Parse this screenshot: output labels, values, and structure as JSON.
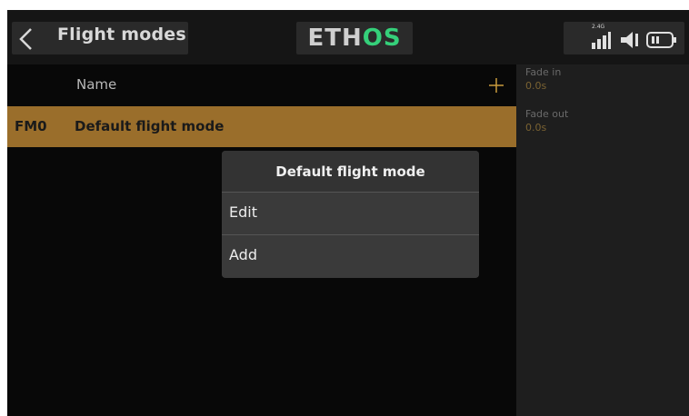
{
  "header": {
    "title": "Flight modes",
    "logo": {
      "part1": "ETH",
      "part2": "OS"
    },
    "status": {
      "band_label": "2.4G"
    }
  },
  "list": {
    "column_name": "Name",
    "rows": [
      {
        "id": "FM0",
        "name": "Default flight mode"
      }
    ]
  },
  "detail": {
    "fade_in_label": "Fade in",
    "fade_in_value": "0.0s",
    "fade_out_label": "Fade out",
    "fade_out_value": "0.0s"
  },
  "popup": {
    "title": "Default flight mode",
    "items": [
      "Edit",
      "Add"
    ]
  },
  "colors": {
    "accent_row": "#9a6e2b",
    "logo_green": "#35d07a",
    "plus_icon": "#c89a3c"
  },
  "icons": [
    "chevron-left-icon",
    "signal-icon",
    "speaker-icon",
    "battery-icon",
    "plus-icon"
  ]
}
